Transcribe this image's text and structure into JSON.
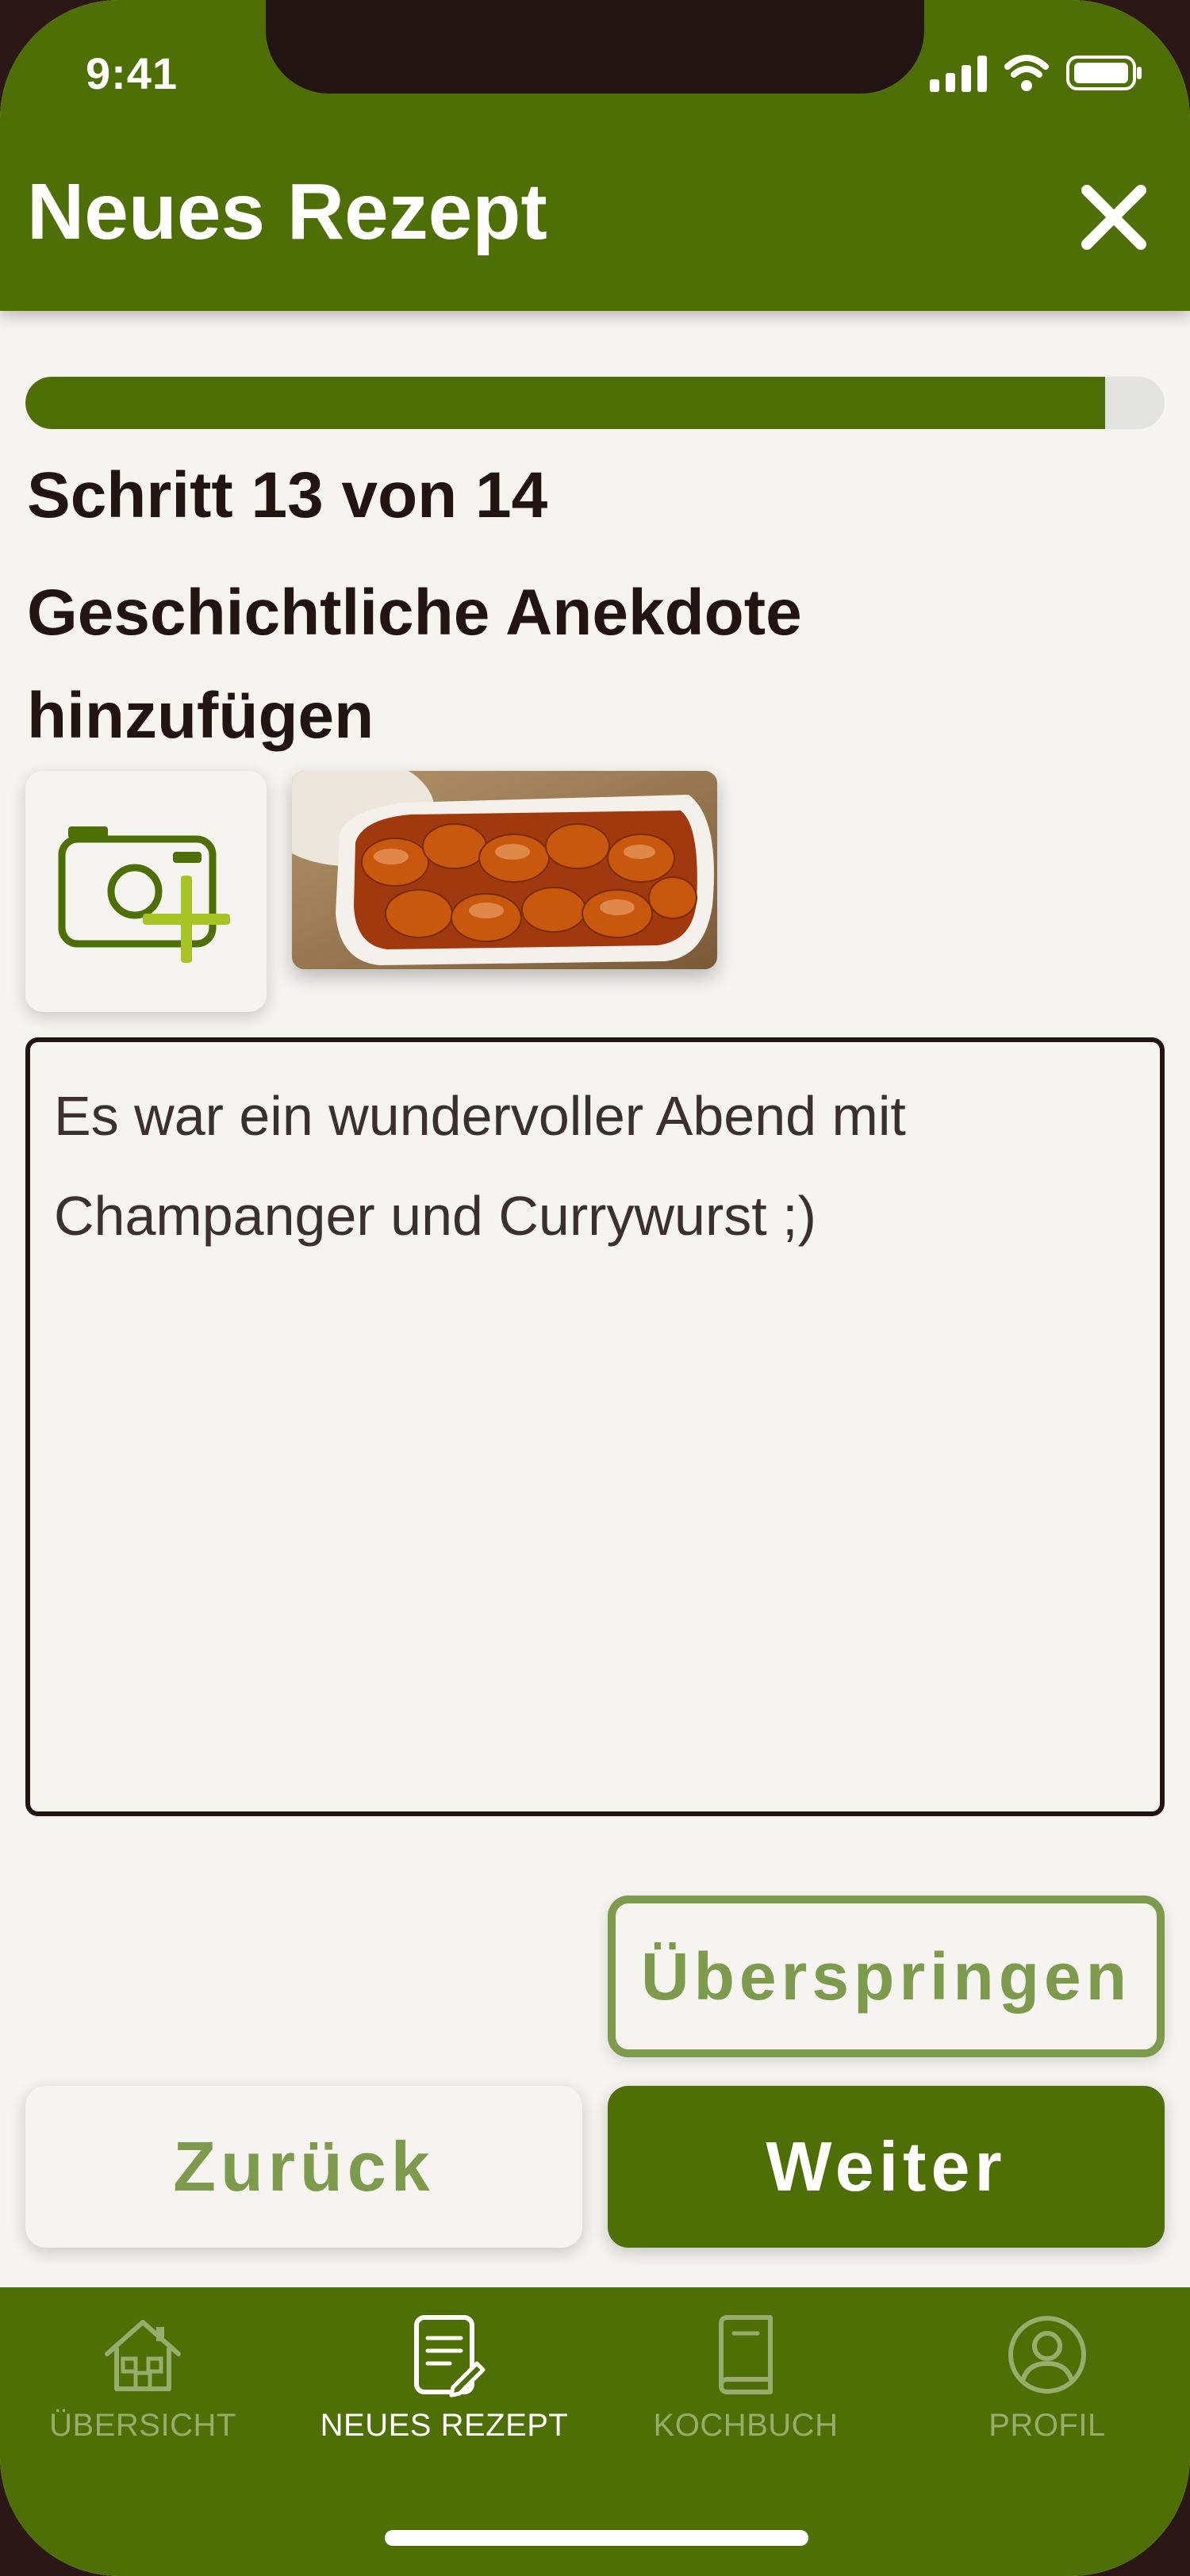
{
  "status_bar": {
    "time": "9:41"
  },
  "header": {
    "title": "Neues Rezept"
  },
  "progress": {
    "current_step": 13,
    "total_steps": 14,
    "fraction": 0.948
  },
  "step": {
    "label": "Schritt 13 von 14",
    "title": "Geschichtliche Anekdote hinzufügen"
  },
  "anecdote": {
    "value": "Es war ein wundervoller Abend mit Champanger und Currywurst ;)"
  },
  "buttons": {
    "skip": "Überspringen",
    "back": "Zurück",
    "next": "Weiter"
  },
  "tabs": [
    {
      "label": "ÜBERSICHT",
      "icon": "house-icon",
      "active": false
    },
    {
      "label": "NEUES REZEPT",
      "icon": "note-edit-icon",
      "active": true
    },
    {
      "label": "KOCHBUCH",
      "icon": "book-icon",
      "active": false
    },
    {
      "label": "PROFIL",
      "icon": "user-circle-icon",
      "active": false
    }
  ],
  "colors": {
    "brand_green": "#4e6e06",
    "muted_green": "#7e9a4d",
    "dark_text": "#231414",
    "background": "#f6f4f1"
  }
}
